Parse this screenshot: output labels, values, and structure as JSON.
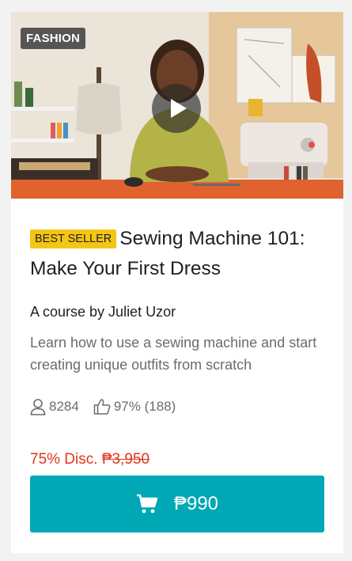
{
  "thumbnail": {
    "category_tag": "FASHION"
  },
  "course": {
    "badge": "BEST SELLER",
    "title": "Sewing Machine 101: Make Your First Dress",
    "author": "A course by Juliet Uzor",
    "description": "Learn how to use a sewing machine and start creating unique outfits from scratch"
  },
  "stats": {
    "students": "8284",
    "rating": "97% (188)"
  },
  "pricing": {
    "discount": "75% Disc.",
    "original_price": "₱3,950",
    "price": "₱990"
  },
  "icons": {
    "students": "user-icon",
    "rating": "thumbs-up-icon",
    "cart": "cart-icon",
    "play": "play-icon"
  },
  "colors": {
    "accent": "#00a8b5",
    "discount": "#e0361b",
    "badge": "#f5c515"
  }
}
